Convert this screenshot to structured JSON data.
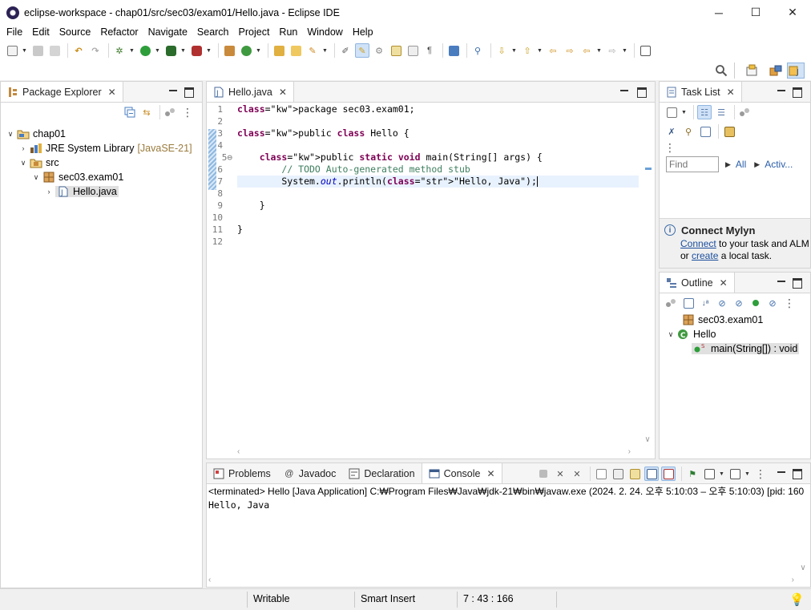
{
  "window": {
    "title": "eclipse-workspace - chap01/src/sec03/exam01/Hello.java - Eclipse IDE",
    "controls": [
      "─",
      "☐",
      "✕"
    ]
  },
  "menu": [
    "File",
    "Edit",
    "Source",
    "Refactor",
    "Navigate",
    "Search",
    "Project",
    "Run",
    "Window",
    "Help"
  ],
  "package_explorer": {
    "tab_label": "Package Explorer",
    "tree": [
      {
        "label": "chap01",
        "decor": "",
        "depth": 0,
        "expanded": true,
        "icon": "project-icon"
      },
      {
        "label": "JRE System Library",
        "decor": "[JavaSE-21]",
        "depth": 1,
        "expanded": false,
        "icon": "library-icon"
      },
      {
        "label": "src",
        "decor": "",
        "depth": 1,
        "expanded": true,
        "icon": "source-folder-icon"
      },
      {
        "label": "sec03.exam01",
        "decor": "",
        "depth": 2,
        "expanded": true,
        "icon": "package-icon"
      },
      {
        "label": "Hello.java",
        "decor": "",
        "depth": 3,
        "expanded": false,
        "icon": "java-file-icon",
        "selected": true
      }
    ]
  },
  "editor": {
    "tab_label": "Hello.java",
    "line_numbers": [
      "1",
      "2",
      "3",
      "4",
      "5⊖",
      "6",
      "7",
      "8",
      "9",
      "10",
      "11",
      "12"
    ],
    "lines": [
      "package sec03.exam01;",
      "",
      "public class Hello {",
      "",
      "    public static void main(String[] args) {",
      "        // TODO Auto-generated method stub",
      "        System.out.println(\"Hello, Java\");",
      "",
      "    }",
      "",
      "}",
      ""
    ]
  },
  "task_list": {
    "tab_label": "Task List",
    "find_placeholder": "Find",
    "all_label": "All",
    "activate_label": "Activ..."
  },
  "mylyn": {
    "title": "Connect Mylyn",
    "connect_link": "Connect",
    "line1_rest": " to your task and ALM",
    "line2_prefix": "or ",
    "create_link": "create",
    "line2_rest": " a local task."
  },
  "outline": {
    "tab_label": "Outline",
    "items": [
      {
        "label": "sec03.exam01",
        "icon": "package-icon"
      },
      {
        "label": "Hello",
        "icon": "class-icon"
      },
      {
        "label": "main(String[]) : void",
        "icon": "method-icon"
      }
    ]
  },
  "bottom_tabs": [
    {
      "label": "Problems",
      "icon": "problems-icon"
    },
    {
      "label": "Javadoc",
      "icon": "javadoc-icon"
    },
    {
      "label": "Declaration",
      "icon": "declaration-icon"
    },
    {
      "label": "Console",
      "icon": "console-icon"
    }
  ],
  "console": {
    "header": "<terminated> Hello [Java Application] C:₩Program Files₩Java₩jdk-21₩bin₩javaw.exe  (2024. 2. 24. 오후 5:10:03 – 오후 5:10:03) [pid: 160",
    "output": "Hello, Java"
  },
  "status": {
    "writable": "Writable",
    "insert_mode": "Smart Insert",
    "position": "7 : 43 : 166"
  },
  "colors": {
    "keyword": "#7f0055",
    "comment": "#3f7f5f",
    "string": "#2a00ff",
    "field": "#0000c0",
    "current_line": "#e8f2fe"
  }
}
